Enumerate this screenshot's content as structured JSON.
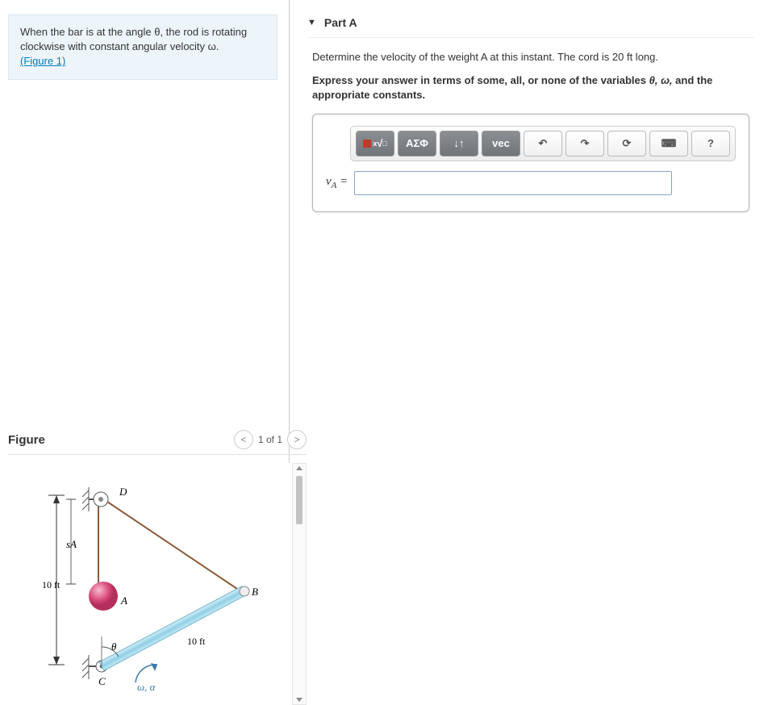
{
  "problem": {
    "intro_html": "When the bar is at the angle θ, the rod is rotating clockwise with constant angular velocity ω.",
    "figure_link": "(Figure 1)"
  },
  "figure": {
    "title": "Figure",
    "pager": "1 of 1",
    "labels": {
      "sA": "sA",
      "tenft_v": "10 ft",
      "tenft_bar": "10 ft",
      "D": "D",
      "A": "A",
      "B": "B",
      "C": "C",
      "theta": "θ",
      "omega_alpha": "ω, α"
    }
  },
  "part": {
    "label": "Part A",
    "question": "Determine the velocity of the weight A at this instant. The cord is 20 ft long.",
    "instruction_prefix": "Express your answer in terms of some, all, or none of the variables ",
    "instruction_vars": "θ, ω,",
    "instruction_suffix": " and the appropriate constants.",
    "answer_label_html": "v<sub>A</sub> ="
  },
  "toolbar": {
    "templates": "√",
    "greek": "ΑΣΦ",
    "subsup": "↓↑",
    "vec": "vec",
    "undo": "↶",
    "redo": "↷",
    "reset": "⟳",
    "keyboard": "⌨",
    "help": "?"
  }
}
